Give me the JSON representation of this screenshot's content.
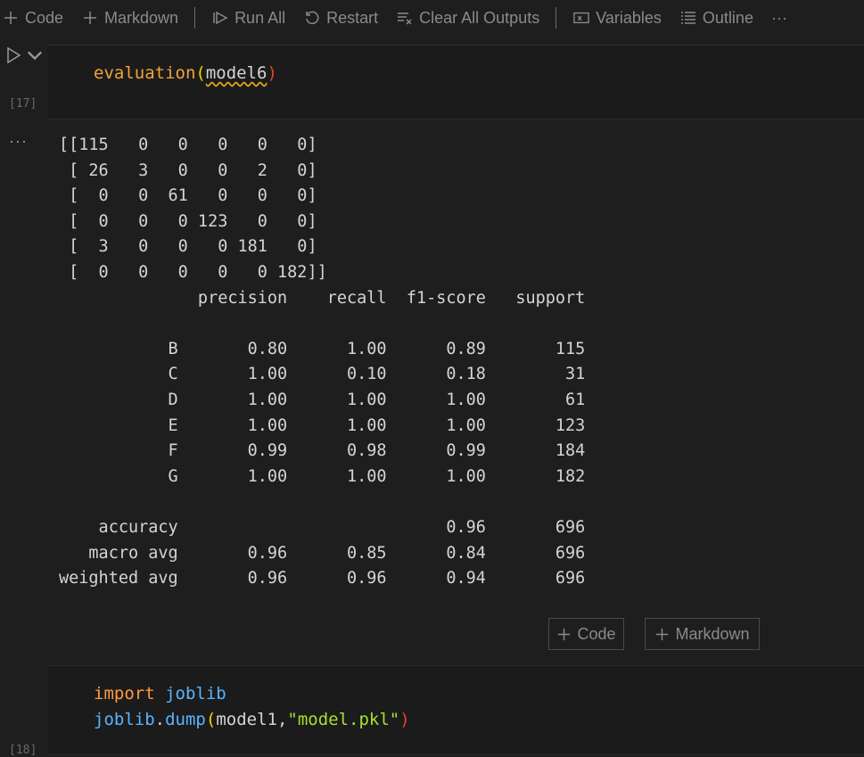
{
  "toolbar": {
    "code_label": "Code",
    "markdown_label": "Markdown",
    "run_all_label": "Run All",
    "restart_label": "Restart",
    "clear_outputs_label": "Clear All Outputs",
    "variables_label": "Variables",
    "outline_label": "Outline",
    "more_label": "···"
  },
  "cell1": {
    "exec_count": "[17]",
    "code": {
      "func": "evaluation",
      "open": "(",
      "arg": "model6",
      "close": ")"
    }
  },
  "output": {
    "more_label": "···",
    "text": "[[115   0   0   0   0   0]\n [ 26   3   0   0   2   0]\n [  0   0  61   0   0   0]\n [  0   0   0 123   0   0]\n [  3   0   0   0 181   0]\n [  0   0   0   0   0 182]]\n              precision    recall  f1-score   support\n\n           B       0.80      1.00      0.89       115\n           C       1.00      0.10      0.18        31\n           D       1.00      1.00      1.00        61\n           E       1.00      1.00      1.00       123\n           F       0.99      0.98      0.99       184\n           G       1.00      1.00      1.00       182\n\n    accuracy                           0.96       696\n   macro avg       0.96      0.85      0.84       696\nweighted avg       0.96      0.96      0.94       696"
  },
  "add_cell": {
    "code_label": "Code",
    "markdown_label": "Markdown"
  },
  "cell2": {
    "exec_count": "[18]",
    "line1": {
      "kw": "import",
      "mod": "joblib"
    },
    "line2": {
      "mod": "joblib",
      "dot": ".",
      "func": "dump",
      "open": "(",
      "arg1": "model1",
      "comma": ",",
      "arg2": "\"model.pkl\"",
      "close": ")"
    }
  },
  "colors": {
    "background": "#1e1e1e",
    "cell_background": "#1b1b1b",
    "keyword": "#ff9a3c",
    "module": "#59b4ff",
    "string": "#a6e22e",
    "error_paren": "#e9412d"
  }
}
